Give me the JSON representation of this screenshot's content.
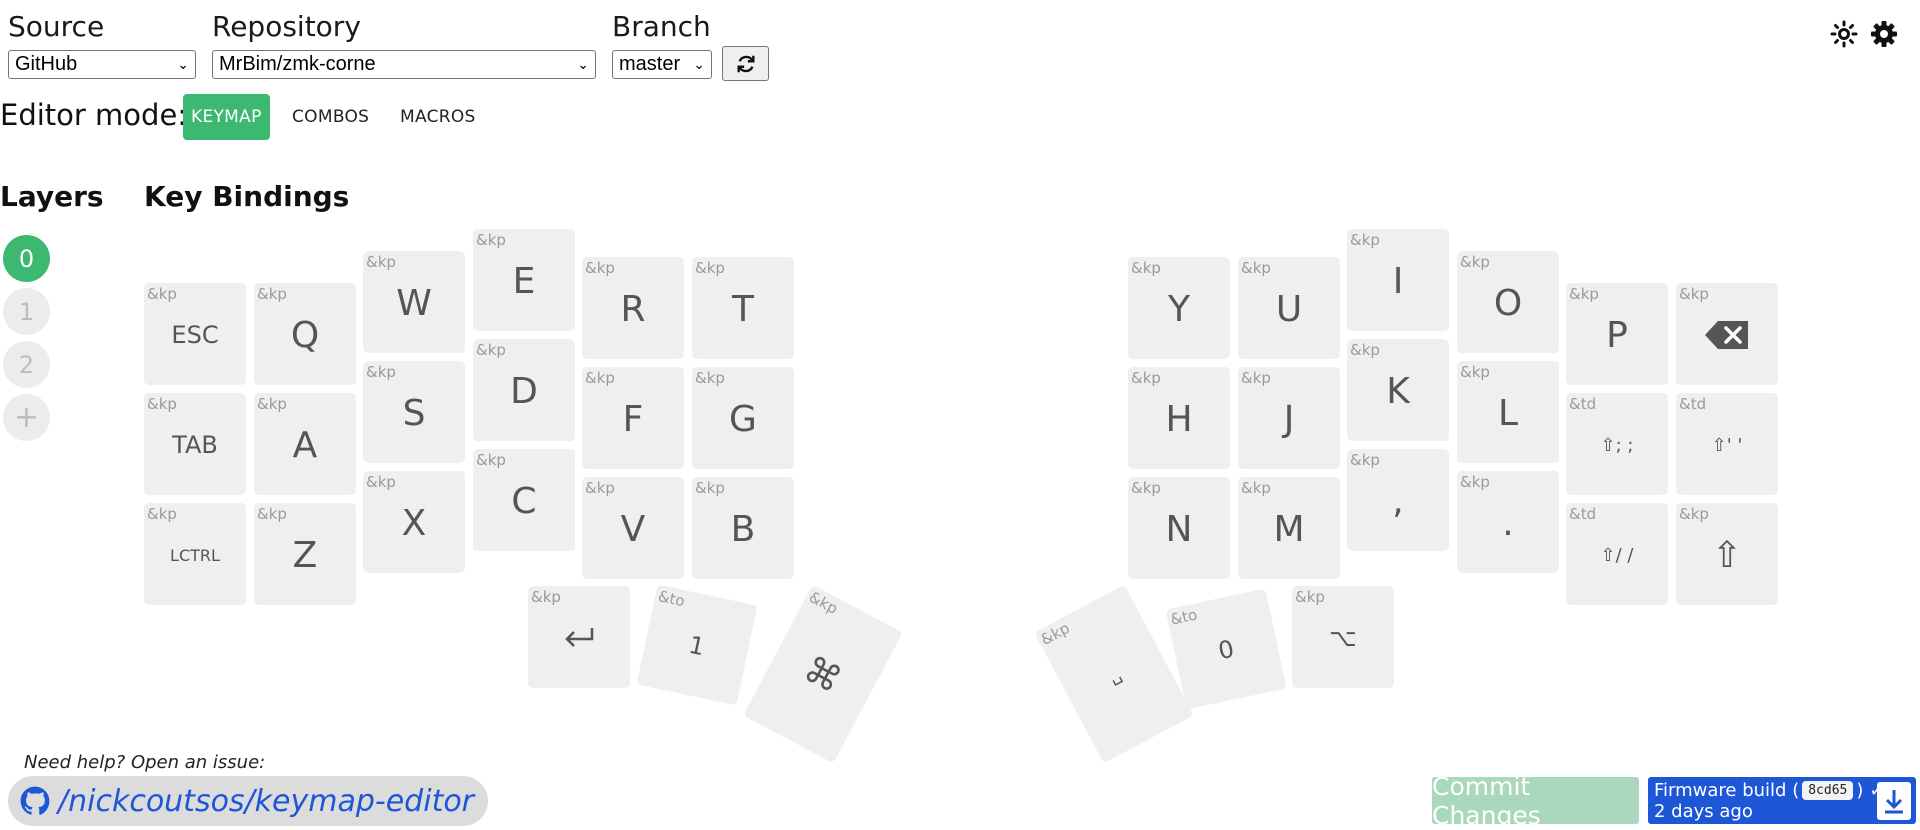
{
  "header": {
    "source": {
      "label": "Source",
      "value": "GitHub"
    },
    "repository": {
      "label": "Repository",
      "value": "MrBim/zmk-corne"
    },
    "branch": {
      "label": "Branch",
      "value": "master"
    }
  },
  "editor_mode": {
    "label": "Editor mode:",
    "tabs": [
      {
        "label": "KEYMAP",
        "active": true
      },
      {
        "label": "COMBOS",
        "active": false
      },
      {
        "label": "MACROS",
        "active": false
      }
    ]
  },
  "layers": {
    "heading": "Layers",
    "items": [
      "0",
      "1",
      "2"
    ],
    "active": "0",
    "add_label": "+"
  },
  "bindings_heading": "Key Bindings",
  "keys": {
    "esc": {
      "bind": "&kp",
      "label": "ESC"
    },
    "q": {
      "bind": "&kp",
      "label": "Q"
    },
    "w": {
      "bind": "&kp",
      "label": "W"
    },
    "e": {
      "bind": "&kp",
      "label": "E"
    },
    "r": {
      "bind": "&kp",
      "label": "R"
    },
    "t": {
      "bind": "&kp",
      "label": "T"
    },
    "tab": {
      "bind": "&kp",
      "label": "TAB"
    },
    "a": {
      "bind": "&kp",
      "label": "A"
    },
    "s": {
      "bind": "&kp",
      "label": "S"
    },
    "d": {
      "bind": "&kp",
      "label": "D"
    },
    "f": {
      "bind": "&kp",
      "label": "F"
    },
    "g": {
      "bind": "&kp",
      "label": "G"
    },
    "lctrl": {
      "bind": "&kp",
      "label": "LCTRL"
    },
    "z": {
      "bind": "&kp",
      "label": "Z"
    },
    "x": {
      "bind": "&kp",
      "label": "X"
    },
    "c": {
      "bind": "&kp",
      "label": "C"
    },
    "v": {
      "bind": "&kp",
      "label": "V"
    },
    "b": {
      "bind": "&kp",
      "label": "B"
    },
    "y": {
      "bind": "&kp",
      "label": "Y"
    },
    "u": {
      "bind": "&kp",
      "label": "U"
    },
    "i": {
      "bind": "&kp",
      "label": "I"
    },
    "o": {
      "bind": "&kp",
      "label": "O"
    },
    "p": {
      "bind": "&kp",
      "label": "P"
    },
    "bspc": {
      "bind": "&kp",
      "icon": "backspace-icon"
    },
    "h": {
      "bind": "&kp",
      "label": "H"
    },
    "j": {
      "bind": "&kp",
      "label": "J"
    },
    "k": {
      "bind": "&kp",
      "label": "K"
    },
    "l": {
      "bind": "&kp",
      "label": "L"
    },
    "semi": {
      "bind": "&td",
      "label": "⇧; ;"
    },
    "quote": {
      "bind": "&td",
      "label": "⇧' '"
    },
    "n": {
      "bind": "&kp",
      "label": "N"
    },
    "m": {
      "bind": "&kp",
      "label": "M"
    },
    "comma": {
      "bind": "&kp",
      "label": ","
    },
    "dot": {
      "bind": "&kp",
      "label": "."
    },
    "slash": {
      "bind": "&td",
      "label": "⇧/ /"
    },
    "shift": {
      "bind": "&kp",
      "label": "⇧"
    },
    "enter": {
      "bind": "&kp",
      "icon": "return-icon"
    },
    "to1": {
      "bind": "&to",
      "label": "1"
    },
    "cmd": {
      "bind": "&kp",
      "label": "⌘"
    },
    "space": {
      "bind": "&kp",
      "label": "␣"
    },
    "to0": {
      "bind": "&to",
      "label": "0"
    },
    "alt": {
      "bind": "&kp",
      "label": "⌥"
    }
  },
  "footer": {
    "help_text": "Need help? Open an issue:",
    "repo_link": "/nickcoutsos/keymap-editor",
    "commit_label": "Commit Changes",
    "firmware": {
      "label": "Firmware build (",
      "hash": "8cd65",
      "close": ")",
      "status": "✓",
      "age": "2 days ago"
    }
  },
  "colors": {
    "accent": "#3db870",
    "link": "#1e56d8",
    "key_bg": "#efefef",
    "commit_disabled": "#a9d8bc"
  }
}
